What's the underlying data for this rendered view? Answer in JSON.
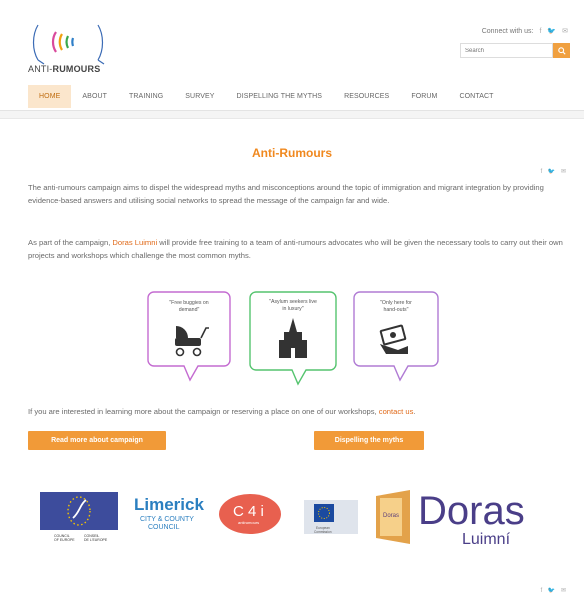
{
  "brand": {
    "logo_text_a": "ANTI-",
    "logo_text_b": "RUMOURS"
  },
  "header": {
    "connect_label": "Connect with us:",
    "social": [
      "f",
      "t",
      "e"
    ],
    "search_placeholder": "Search"
  },
  "nav": {
    "items": [
      {
        "label": "HOME",
        "active": true
      },
      {
        "label": "ABOUT"
      },
      {
        "label": "TRAINING"
      },
      {
        "label": "SURVEY"
      },
      {
        "label": "DISPELLING THE MYTHS"
      },
      {
        "label": "RESOURCES"
      },
      {
        "label": "FORUM"
      },
      {
        "label": "CONTACT"
      }
    ]
  },
  "main": {
    "title": "Anti-Rumours",
    "p1": "The anti-rumours campaign aims to dispel the widespread myths and misconceptions around the topic of immigration and migrant integration by providing evidence-based answers and utilising social networks to spread the message of the campaign far and wide.",
    "p2_pre": "As part of the campaign, ",
    "p2_link": "Doras Luimni",
    "p2_post": " will provide free training to a team of anti-rumours advocates who will be given the necessary tools to carry out their own projects and workshops which challenge the most common myths.",
    "bubbles": [
      {
        "text_l1": "\"Free buggies on",
        "text_l2": "demand\"",
        "color": "#c46bd1"
      },
      {
        "text_l1": "\"Asylum seekers live",
        "text_l2": "in luxury\"",
        "color": "#55c46f"
      },
      {
        "text_l1": "\"Only here for",
        "text_l2": "hand-outs\"",
        "color": "#b07bd4"
      }
    ],
    "cta_pre": "If you are interested in learning more about the campaign or reserving a place on one of our workshops, ",
    "cta_link": "contact us",
    "cta_post": ".",
    "btn_read": "Read more about campaign",
    "btn_myths": "Dispelling the myths"
  },
  "partners": {
    "coe_l1a": "COUNCIL",
    "coe_l2a": "OF EUROPE",
    "coe_l1b": "CONSEIL",
    "coe_l2b": "DE L'EUROPE",
    "limerick_l1": "Limerick",
    "limerick_l2": "CITY & COUNTY",
    "limerick_l3": "COUNCIL",
    "c4i": "C 4 i",
    "c4i_sub": "antirumours",
    "eu_l1": "European",
    "eu_l2": "Commission",
    "doras_door": "Doras",
    "doras_big": "Doras",
    "luimni": "Luimní"
  },
  "colors": {
    "accent": "#f0881e",
    "button": "#f19a38",
    "nav_active_bg": "#fbe6cc"
  }
}
